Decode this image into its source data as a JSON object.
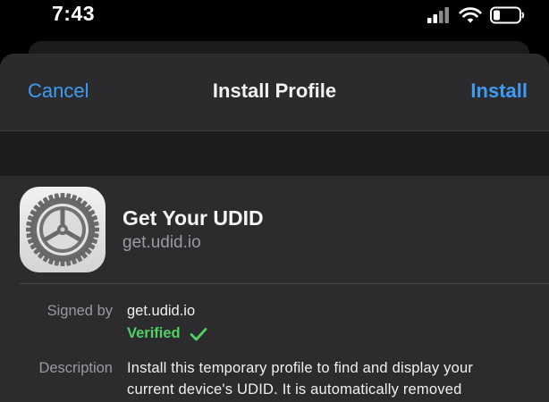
{
  "status_bar": {
    "time": "7:43",
    "icons": [
      "signal-icon",
      "wifi-icon",
      "battery-icon"
    ]
  },
  "nav": {
    "cancel_label": "Cancel",
    "title": "Install Profile",
    "install_label": "Install"
  },
  "profile": {
    "icon": "settings-gear-icon",
    "name": "Get Your UDID",
    "domain": "get.udid.io"
  },
  "details": {
    "signed_by_label": "Signed by",
    "signed_by_value": "get.udid.io",
    "verified_label": "Verified",
    "description_label": "Description",
    "description_lines": [
      "Install this temporary profile to find and display your",
      "current device's UDID. It is automatically removed"
    ]
  },
  "colors": {
    "accent": "#3e9bf3",
    "verified": "#4fd163",
    "sheet_bg": "#2c2c2e"
  }
}
